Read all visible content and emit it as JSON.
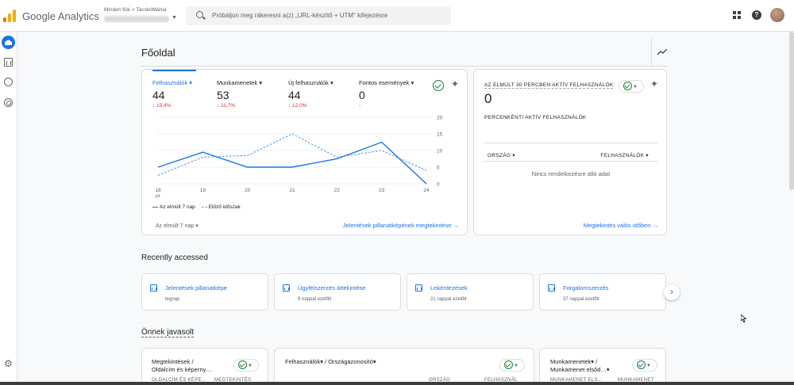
{
  "app": {
    "title": "Google Analytics"
  },
  "account": {
    "path": "Minden fiók > TacskóMánia"
  },
  "search": {
    "placeholder": "Próbáljon meg rákeresni a(z) „URL-készítő + UTM\" kifejezésre"
  },
  "page": {
    "title": "Főoldal"
  },
  "overview": {
    "metrics": [
      {
        "label": "Felhasználók",
        "value": "44",
        "delta": "↓ 15,4%"
      },
      {
        "label": "Munkamenetek",
        "value": "53",
        "delta": "↓ 11,7%"
      },
      {
        "label": "Új felhasználók",
        "value": "44",
        "delta": "↓ 12,0%"
      },
      {
        "label": "Fontos események",
        "value": "0",
        "delta": "-"
      }
    ],
    "legend_current": "Az elmúlt 7 nap",
    "legend_previous": "Előző időszak",
    "date_range": "Az elmúlt 7 nap",
    "link": "Jelentések pillanatképének megtekintése"
  },
  "chart_data": {
    "type": "line",
    "x": [
      "18",
      "19",
      "20",
      "21",
      "22",
      "23",
      "24"
    ],
    "x_sublabel": "júl.",
    "series": [
      {
        "name": "Az elmúlt 7 nap",
        "values": [
          5,
          9.5,
          5,
          5,
          7.5,
          12.5,
          0
        ]
      },
      {
        "name": "Előző időszak",
        "values": [
          2.5,
          8,
          8.5,
          15,
          8,
          10,
          4
        ]
      }
    ],
    "yticks": [
      "20",
      "15",
      "10",
      "5",
      "0"
    ],
    "ylim": [
      0,
      20
    ],
    "grid": true
  },
  "realtime": {
    "title": "AZ ELMÚLT 30 PERCBEN AKTÍV FELHASZNÁLÓK",
    "value": "0",
    "subtitle": "PERCENKÉNTI AKTÍV FELHASZNÁLÓK",
    "col_country": "ORSZÁG",
    "col_users": "FELHASZNÁLÓK",
    "empty": "Nincs rendelkezésre álló adat",
    "link": "Megtekintés valós időben"
  },
  "recent": {
    "title": "Recently accessed",
    "items": [
      {
        "title": "Jelentések pillanatképe",
        "sub": "tegnap"
      },
      {
        "title": "Ügyfélszerzés áttekintése",
        "sub": "9 nappal ezelőtt"
      },
      {
        "title": "Lekérdezések",
        "sub": "21 nappal ezelőtt"
      },
      {
        "title": "Forgalomszerzés",
        "sub": "37 nappal ezelőtt"
      }
    ]
  },
  "suggested": {
    "title": "Önnek javasolt",
    "cards": [
      {
        "title_line1": "Megtekintések /",
        "title_line2": "Oldalcím és képerny…",
        "head1": "OLDALCÍM ÉS KÉPE…",
        "head2": "MEGTEKINTÉS"
      },
      {
        "title_line1": "Felhasználók▾ / Országazonosító▾",
        "title_line2": "",
        "head1": "ORSZÁG",
        "head2": "FELHASZNÁL"
      },
      {
        "title_line1": "Munkamenetek▾ /",
        "title_line2": "Munkamenet elsőd…▾",
        "head1": "MUNKAMENET ELS…",
        "head2": "MUNKAMENET"
      }
    ]
  },
  "colors": {
    "accent": "#1a73e8",
    "negative": "#d93025",
    "positive": "#188038"
  },
  "icons": [
    "search-icon",
    "apps-icon",
    "help-icon",
    "home-icon",
    "reports-icon",
    "explore-icon",
    "advertising-icon",
    "settings-icon",
    "insights-icon",
    "sparkle-icon",
    "check-icon",
    "chevron-right-icon",
    "arrow-right-icon"
  ]
}
